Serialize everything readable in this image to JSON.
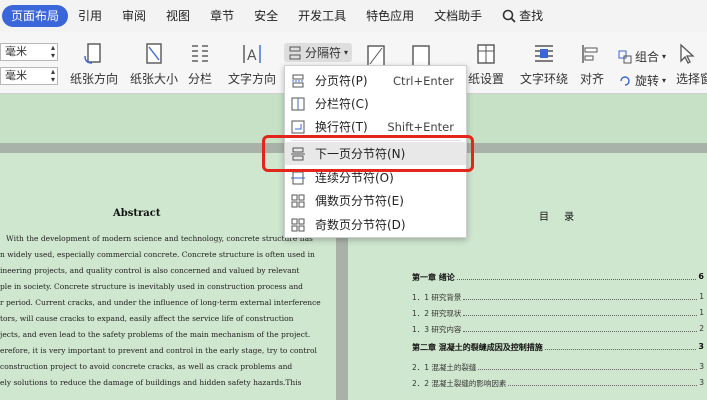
{
  "menubar": {
    "tabs": [
      "页面布局",
      "引用",
      "审阅",
      "视图",
      "章节",
      "安全",
      "开发工具",
      "特色应用",
      "文档助手"
    ],
    "search_label": "查找"
  },
  "toolbar": {
    "margin_top_value": "毫米",
    "margin_bottom_value": "毫米",
    "buttons": {
      "orientation": "纸张方向",
      "size": "纸张大小",
      "columns": "分栏",
      "text_direction": "文字方向",
      "separator": "分隔符",
      "page_setup": "纸设置",
      "text_wrap": "文字环绕",
      "align": "对齐",
      "group": "组合",
      "rotate": "旋转",
      "select_pane": "选择窗"
    }
  },
  "dropdown": {
    "items": [
      {
        "label": "分页符(P)",
        "shortcut": "Ctrl+Enter"
      },
      {
        "label": "分栏符(C)",
        "shortcut": ""
      },
      {
        "label": "换行符(T)",
        "shortcut": "Shift+Enter"
      },
      {
        "label": "下一页分节符(N)",
        "shortcut": ""
      },
      {
        "label": "连续分节符(O)",
        "shortcut": ""
      },
      {
        "label": "偶数页分节符(E)",
        "shortcut": ""
      },
      {
        "label": "奇数页分节符(D)",
        "shortcut": ""
      }
    ]
  },
  "left_page": {
    "title": "Abstract",
    "lines": [
      "With the development of modern science and technology, concrete structure has",
      "n widely used, especially commercial concrete. Concrete structure is often used in",
      "ineering projects, and quality control is also concerned and valued by relevant",
      "ple in society. Concrete structure is inevitably used in construction process and",
      "r period. Current cracks, and under the influence of long-term external interference",
      "tors, will cause cracks to expand, easily affect the service life of construction",
      "jects, and even lead to the safety problems of the main mechanism of the project.",
      "erefore, it is very important to prevent and control in the early stage, try to control",
      "construction project to avoid concrete cracks, as well as crack problems and",
      "ely solutions to reduce the damage of buildings and hidden safety hazards.This"
    ]
  },
  "right_page": {
    "title": "目 录",
    "toc": [
      {
        "text": "第一章  绪论",
        "page": "6",
        "chapter": true
      },
      {
        "text": "1．1 研究背景",
        "page": "1",
        "chapter": false
      },
      {
        "text": "1．2 研究现状",
        "page": "1",
        "chapter": false
      },
      {
        "text": "1．3 研究内容",
        "page": "2",
        "chapter": false
      },
      {
        "text": "第二章  混凝土的裂缝成因及控制措施",
        "page": "3",
        "chapter": true
      },
      {
        "text": "2．1 混凝土的裂缝",
        "page": "3",
        "chapter": false
      },
      {
        "text": "2．2 混凝土裂缝的影响因素",
        "page": "3",
        "chapter": false
      }
    ]
  }
}
